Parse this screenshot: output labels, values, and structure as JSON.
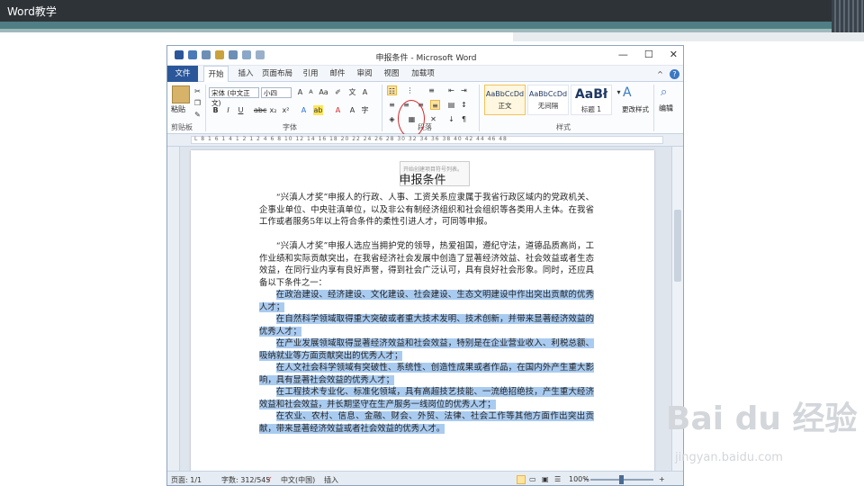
{
  "slide": {
    "title": "Word教学"
  },
  "window": {
    "title": "申报条件 - Microsoft Word",
    "controls": {
      "minimize": "—",
      "maximize": "☐",
      "close": "✕"
    }
  },
  "tabs": [
    {
      "label": "文件"
    },
    {
      "label": "开始"
    },
    {
      "label": "插入"
    },
    {
      "label": "页面布局"
    },
    {
      "label": "引用"
    },
    {
      "label": "邮件"
    },
    {
      "label": "审阅"
    },
    {
      "label": "视图"
    },
    {
      "label": "加载项"
    }
  ],
  "ribbon": {
    "clipboard": {
      "paste": "粘贴",
      "label": "剪贴板"
    },
    "font": {
      "name": "宋体 (中文正文)",
      "size": "小四",
      "label": "字体"
    },
    "paragraph": {
      "label": "段落",
      "tooltip": "开始创建项目符号列表。"
    },
    "styles": {
      "label": "样式",
      "items": [
        {
          "sample": "AaBbCcDd",
          "name": "正文"
        },
        {
          "sample": "AaBbCcDd",
          "name": "无间隔"
        },
        {
          "sample": "AaBł",
          "name": "标题 1"
        }
      ],
      "change_styles": "更改样式"
    },
    "editing": {
      "label": "编辑"
    }
  },
  "ruler": {
    "marks": "L 8 1 6 1 4 1 2 1 2 4 6 8 10 12 14 16 18 20 22 24 26 28 30 32 34 36 38 40 42 44 46 48"
  },
  "document": {
    "title": "申报条件",
    "paragraphs": [
      {
        "text": "“兴滇人才奖”申报人的行政、人事、工资关系应隶属于我省行政区域内的党政机关、企事业单位、中央驻滇单位，以及非公有制经济组织和社会组织等各类用人主体。在我省工作或者服务5年以上符合条件的柔性引进人才，可同等申报。",
        "highlighted": false
      },
      {
        "text": "“兴滇人才奖”申报人选应当拥护党的领导，热爱祖国，遵纪守法，道德品质高尚，工作业绩和实际贡献突出，在我省经济社会发展中创造了显著经济效益、社会效益或者生态效益，在同行业内享有良好声誉，得到社会广泛认可，具有良好社会形象。同时，还应具备以下条件之一：",
        "highlighted": false
      },
      {
        "text": "在政治建设、经济建设、文化建设、社会建设、生态文明建设中作出突出贡献的优秀人才；",
        "highlighted": true
      },
      {
        "text": "在自然科学领域取得重大突破或者重大技术发明、技术创新，并带来显著经济效益的优秀人才；",
        "highlighted": true
      },
      {
        "text": "在产业发展领域取得显著经济效益和社会效益，特别是在企业营业收入、利税总额、吸纳就业等方面贡献突出的优秀人才；",
        "highlighted": true
      },
      {
        "text": "在人文社会科学领域有突破性、系统性、创造性成果或者作品，在国内外产生重大影响，具有显著社会效益的优秀人才；",
        "highlighted": true
      },
      {
        "text": "在工程技术专业化、标准化领域，具有高超技艺技能、一流绝招绝技，产生重大经济效益和社会效益，并长期坚守在生产服务一线岗位的优秀人才；",
        "highlighted": true
      },
      {
        "text": "在农业、农村、信息、金融、财会、外贸、法律、社会工作等其他方面作出突出贡献，带来显著经济效益或者社会效益的优秀人才。",
        "highlighted": true
      }
    ]
  },
  "statusbar": {
    "page": "页面: 1/1",
    "words": "字数: 312/545",
    "language": "中文(中国)",
    "mode": "插入",
    "zoom": "100%",
    "zoom_out": "−",
    "zoom_in": "+"
  },
  "watermark": {
    "brand": "Bai du 经验",
    "url": "jingyan.baidu.com"
  },
  "colors": {
    "accent": "#2b579a",
    "highlight": "#a9cbf0",
    "annotation": "#d42a2a"
  }
}
